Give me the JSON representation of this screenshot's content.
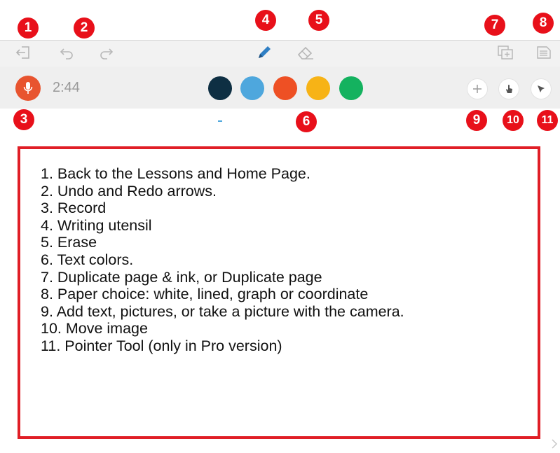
{
  "recorder": {
    "time": "2:44"
  },
  "colors": {
    "accent_record": "#e8542f",
    "badge": "#e8101a",
    "pen": "#2f7fc4",
    "legend_border": "#e01e26"
  },
  "palette": [
    {
      "name": "navy",
      "color": "#0e2f43"
    },
    {
      "name": "light-blue",
      "color": "#4ea7dd"
    },
    {
      "name": "orange-red",
      "color": "#ee5024"
    },
    {
      "name": "yellow",
      "color": "#f7b316"
    },
    {
      "name": "green",
      "color": "#14b25f"
    }
  ],
  "icons": {
    "back": "exit-arrow-icon",
    "undo": "undo-arrow-icon",
    "redo": "redo-arrow-icon",
    "pen": "pencil-icon",
    "eraser": "eraser-icon",
    "duplicate": "duplicate-page-icon",
    "paper": "paper-icon",
    "mic": "microphone-icon",
    "add": "plus-icon",
    "move": "hand-icon",
    "pointer": "pointer-arrow-icon"
  },
  "badges": [
    "1",
    "2",
    "3",
    "4",
    "5",
    "6",
    "7",
    "8",
    "9",
    "10",
    "11"
  ],
  "legend": [
    "1. Back to the Lessons and Home Page.",
    "2. Undo and Redo arrows.",
    "3. Record",
    "4. Writing utensil",
    "5. Erase",
    "6. Text colors.",
    "7. Duplicate page & ink, or Duplicate page",
    "8. Paper choice: white, lined, graph or coordinate",
    "9. Add text, pictures, or take a picture with the camera.",
    "10. Move image",
    "11. Pointer Tool (only in Pro version)"
  ]
}
